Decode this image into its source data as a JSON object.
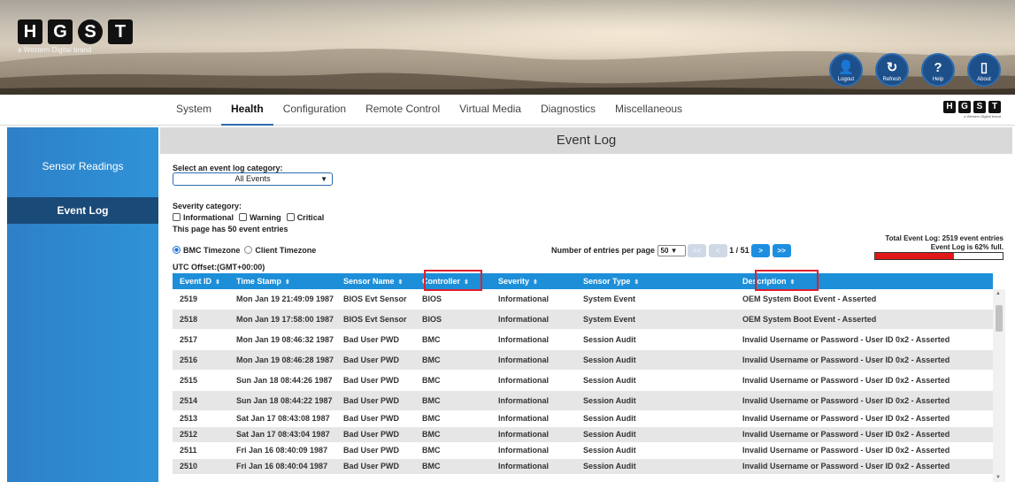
{
  "brand": {
    "letters": [
      "H",
      "G",
      "S",
      "T"
    ],
    "tagline": "a Western Digital brand"
  },
  "top_buttons": [
    {
      "label": "Logout",
      "icon": "user-icon",
      "glyph": "👤"
    },
    {
      "label": "Refresh",
      "icon": "refresh-icon",
      "glyph": "↻"
    },
    {
      "label": "Help",
      "icon": "help-icon",
      "glyph": "?"
    },
    {
      "label": "About",
      "icon": "book-icon",
      "glyph": "▯"
    }
  ],
  "nav": {
    "tabs": [
      "System",
      "Health",
      "Configuration",
      "Remote Control",
      "Virtual Media",
      "Diagnostics",
      "Miscellaneous"
    ],
    "active": "Health"
  },
  "sidebar": {
    "items": [
      {
        "label": "Sensor Readings",
        "active": false
      },
      {
        "label": "Event Log",
        "active": true
      }
    ]
  },
  "page": {
    "title": "Event Log",
    "category_label": "Select an event log category:",
    "category_value": "All Events",
    "severity_label": "Severity category:",
    "severity_options": [
      "Informational",
      "Warning",
      "Critical"
    ],
    "entries_note": "This page has 50 event entries",
    "timezone_bmc": "BMC Timezone",
    "timezone_client": "Client Timezone",
    "utc_offset": "UTC Offset:(GMT+00:00)",
    "per_page_label": "Number of entries per page",
    "per_page_value": "50",
    "page_indicator": "1 / 51",
    "first_btn": "<<",
    "prev_btn": "<",
    "next_btn": ">",
    "last_btn": ">>",
    "total_text": "Total Event Log: 2519 event entries",
    "usage_text": "Event Log is 62% full.",
    "usage_fraction": 0.62
  },
  "table": {
    "columns": [
      "Event ID",
      "Time Stamp",
      "Sensor Name",
      "Controller",
      "Severity",
      "Sensor Type",
      "Description"
    ],
    "sort_glyph": "⬍",
    "rows": [
      [
        "2519",
        "Mon Jan 19 21:49:09 1987",
        "BIOS Evt Sensor",
        "BIOS",
        "Informational",
        "System Event",
        "OEM System Boot Event - Asserted"
      ],
      [
        "2518",
        "Mon Jan 19 17:58:00 1987",
        "BIOS Evt Sensor",
        "BIOS",
        "Informational",
        "System Event",
        "OEM System Boot Event - Asserted"
      ],
      [
        "2517",
        "Mon Jan 19 08:46:32 1987",
        "Bad User PWD",
        "BMC",
        "Informational",
        "Session Audit",
        "Invalid Username or Password - User ID 0x2 - Asserted"
      ],
      [
        "2516",
        "Mon Jan 19 08:46:28 1987",
        "Bad User PWD",
        "BMC",
        "Informational",
        "Session Audit",
        "Invalid Username or Password - User ID 0x2 - Asserted"
      ],
      [
        "2515",
        "Sun Jan 18 08:44:26 1987",
        "Bad User PWD",
        "BMC",
        "Informational",
        "Session Audit",
        "Invalid Username or Password - User ID 0x2 - Asserted"
      ],
      [
        "2514",
        "Sun Jan 18 08:44:22 1987",
        "Bad User PWD",
        "BMC",
        "Informational",
        "Session Audit",
        "Invalid Username or Password - User ID 0x2 - Asserted"
      ],
      [
        "2513",
        "Sat Jan 17 08:43:08 1987",
        "Bad User PWD",
        "BMC",
        "Informational",
        "Session Audit",
        "Invalid Username or Password - User ID 0x2 - Asserted"
      ],
      [
        "2512",
        "Sat Jan 17 08:43:04 1987",
        "Bad User PWD",
        "BMC",
        "Informational",
        "Session Audit",
        "Invalid Username or Password - User ID 0x2 - Asserted"
      ],
      [
        "2511",
        "Fri Jan 16 08:40:09 1987",
        "Bad User PWD",
        "BMC",
        "Informational",
        "Session Audit",
        "Invalid Username or Password - User ID 0x2 - Asserted"
      ],
      [
        "2510",
        "Fri Jan 16 08:40:04 1987",
        "Bad User PWD",
        "BMC",
        "Informational",
        "Session Audit",
        "Invalid Username or Password - User ID 0x2 - Asserted"
      ]
    ]
  },
  "colors": {
    "accent": "#1d8fd8",
    "sidebar": "#2f8ad0",
    "sidebar_active": "#1a4a78",
    "highlight": "#e0202a",
    "usage_fill": "#e01818"
  }
}
